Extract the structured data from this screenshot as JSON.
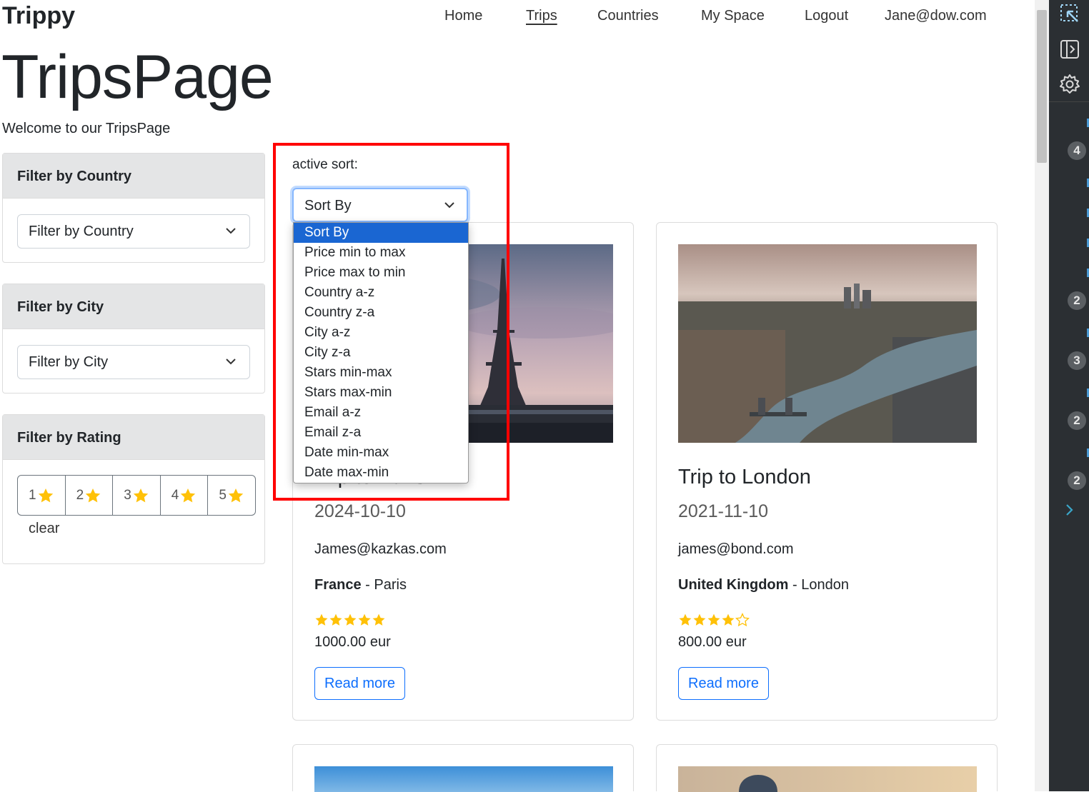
{
  "navbar": {
    "brand": "Trippy",
    "links": [
      "Home",
      "Trips",
      "Countries",
      "My Space",
      "Logout",
      "Jane@dow.com"
    ],
    "active": "Trips"
  },
  "header": {
    "title": "TripsPage",
    "lead": "Welcome to our TripsPage"
  },
  "filters": {
    "country": {
      "title": "Filter by Country",
      "value": "Filter by Country"
    },
    "city": {
      "title": "Filter by City",
      "value": "Filter by City"
    },
    "rating": {
      "title": "Filter by Rating",
      "buttons": [
        "1",
        "2",
        "3",
        "4",
        "5"
      ],
      "clear": "clear"
    }
  },
  "sort": {
    "label": "active sort:",
    "value": "Sort By",
    "options": [
      "Sort By",
      "Price min to max",
      "Price max to min",
      "Country a-z",
      "Country z-a",
      "City a-z",
      "City z-a",
      "Stars min-max",
      "Stars max-min",
      "Email a-z",
      "Email z-a",
      "Date min-max",
      "Date max-min"
    ],
    "selected_index": 0
  },
  "trips": [
    {
      "title": "Trip to Paris",
      "date": "2024-10-10",
      "email": "James@kazkas.com",
      "country": "France",
      "separator": " - ",
      "city": "Paris",
      "stars": 5,
      "price": "1000.00 eur",
      "button": "Read more"
    },
    {
      "title": "Trip to London",
      "date": "2021-11-10",
      "email": "james@bond.com",
      "country": "United Kingdom",
      "separator": " - ",
      "city": "London",
      "stars": 4,
      "price": "800.00 eur",
      "button": "Read more"
    }
  ],
  "side_panel": {
    "badges": [
      "4",
      "2",
      "3",
      "2",
      "2"
    ]
  },
  "colors": {
    "accent": "#0d6efd",
    "star": "#ffc107",
    "highlight": "#ff0000",
    "dropdown_selected": "#1a66d2",
    "card_header": "#e4e5e6"
  }
}
